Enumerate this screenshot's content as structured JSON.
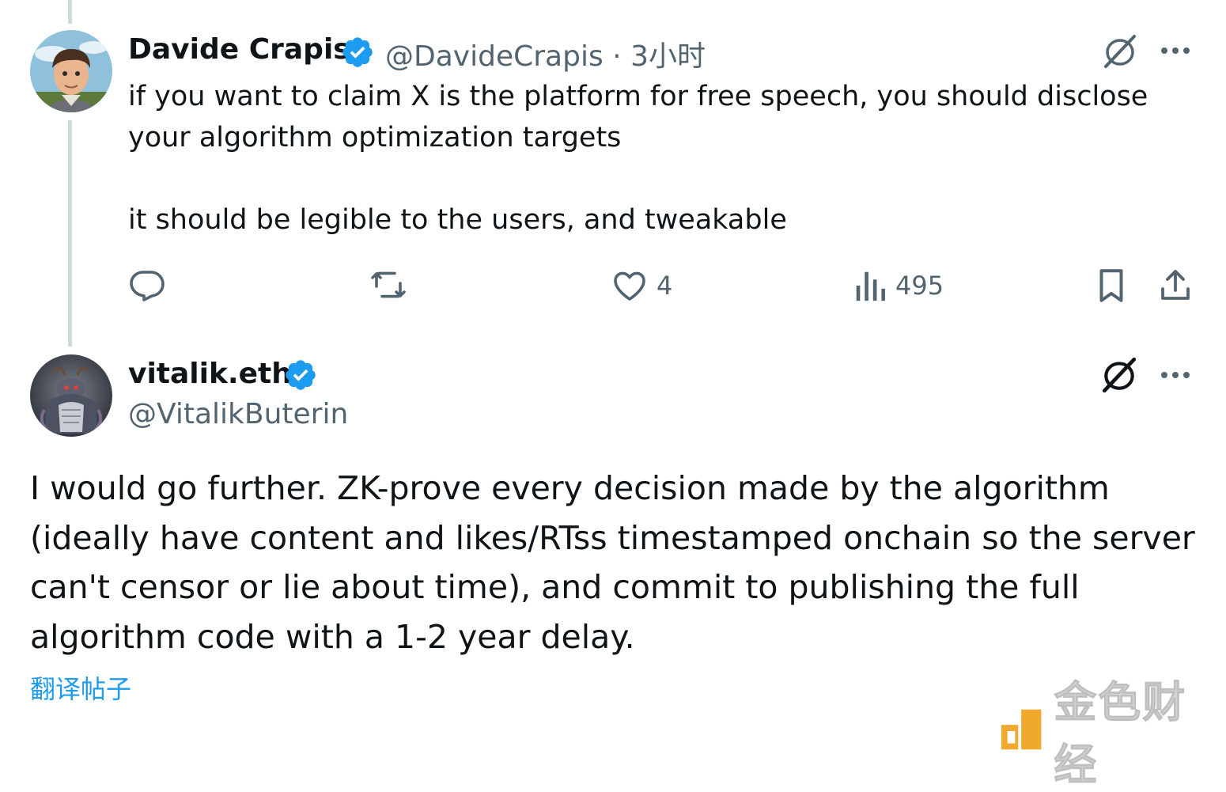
{
  "parent_post": {
    "display_name": "Davide Crapis",
    "handle": "@DavideCrapis",
    "separator": "·",
    "time": "3小时",
    "text_line1": "if you want to claim X is the platform for free speech, you should disclose",
    "text_line2": "your algorithm optimization targets",
    "text_line3": "it should be legible to the users, and tweakable",
    "likes": "4",
    "views": "495",
    "icons": [
      "grok-icon",
      "more-icon",
      "reply-icon",
      "retweet-icon",
      "like-icon",
      "views-icon",
      "bookmark-icon",
      "share-icon"
    ]
  },
  "reply_post": {
    "display_name": "vitalik.eth",
    "handle": "@VitalikButerin",
    "text": "I would go further. ZK-prove every decision made by the algorithm (ideally have content and likes/RTss timestamped onchain so the server can't censor or lie about time), and commit to publishing the full algorithm code with a 1-2 year delay.",
    "translate_label": "翻译帖子"
  },
  "watermark": {
    "text": "金色财经"
  },
  "colors": {
    "accent": "#1d9bf0",
    "secondary_text": "#536471",
    "thread_line": "#cfd9de",
    "watermark_logo": "#f0a92c"
  }
}
